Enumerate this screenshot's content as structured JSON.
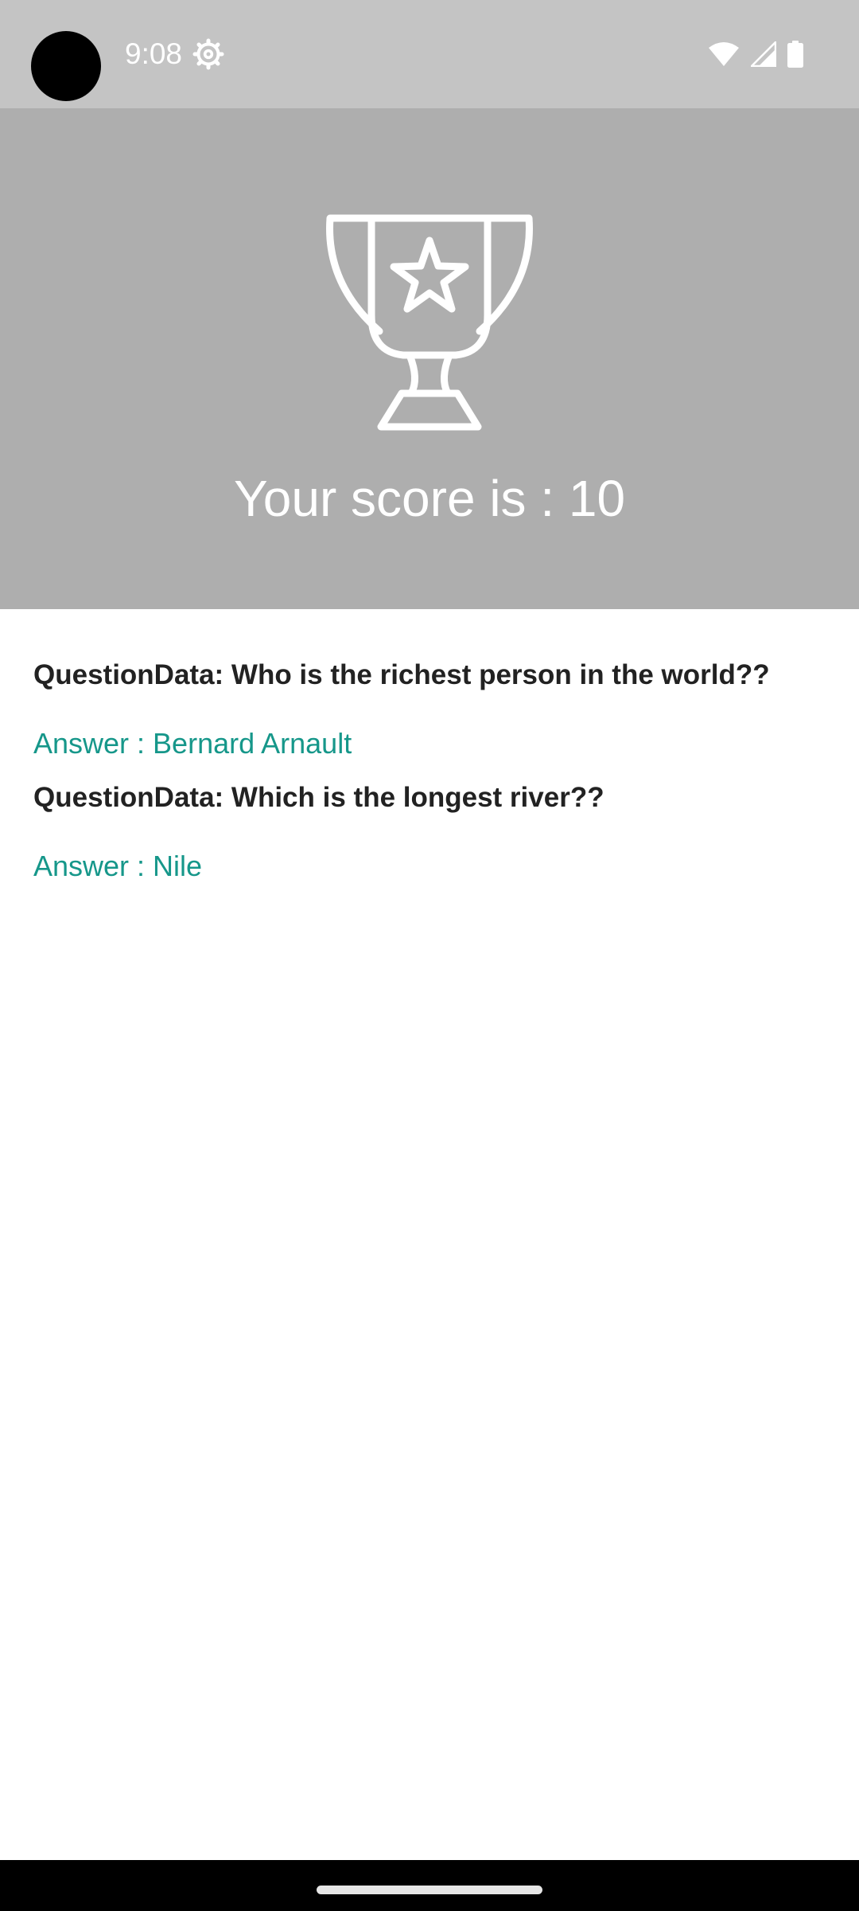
{
  "status_bar": {
    "time": "9:08",
    "icons": [
      "camera-cutout",
      "settings-icon",
      "wifi-icon",
      "cellular-signal-icon",
      "battery-icon"
    ]
  },
  "header": {
    "icon": "trophy-icon",
    "score_text": "Your score is : 10",
    "background_color": "#aeaeae",
    "foreground_color": "#ffffff"
  },
  "results": [
    {
      "question": "QuestionData: Who is the richest person in the world??",
      "answer": "Answer : Bernard Arnault"
    },
    {
      "question": "QuestionData: Which is the longest river??",
      "answer": "Answer : Nile"
    }
  ],
  "colors": {
    "answer_text": "#16978a",
    "question_text": "#222222"
  },
  "nav_bar": {
    "home_indicator": "home-pill"
  }
}
